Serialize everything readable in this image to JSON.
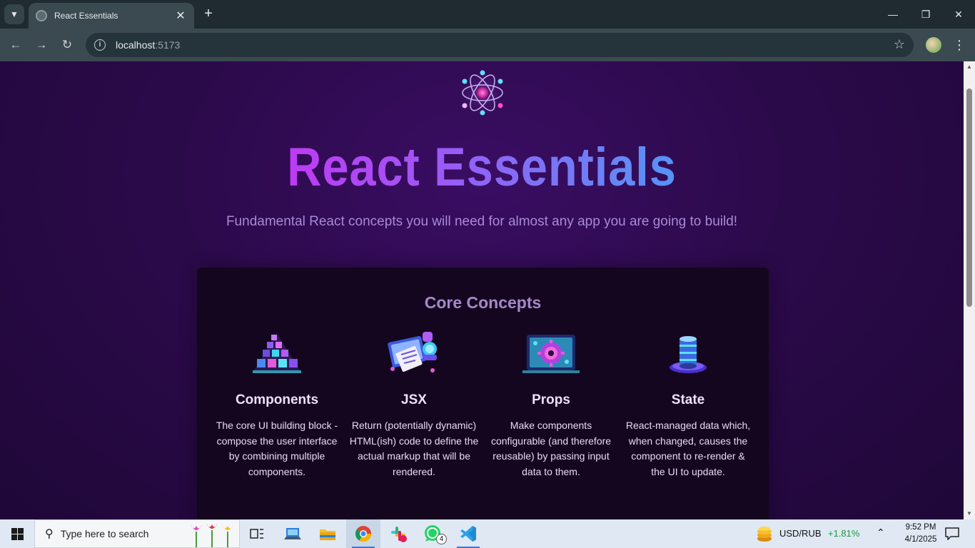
{
  "browser": {
    "tab_title": "React Essentials",
    "url_host": "localhost",
    "url_port": ":5173"
  },
  "page": {
    "title": "React Essentials",
    "subtitle": "Fundamental React concepts you will need for almost any app you are going to build!",
    "core_concepts": {
      "heading": "Core Concepts",
      "items": [
        {
          "name": "Components",
          "description": "The core UI building block - compose the user interface by combining multiple components."
        },
        {
          "name": "JSX",
          "description": "Return (potentially dynamic) HTML(ish) code to define the actual markup that will be rendered."
        },
        {
          "name": "Props",
          "description": "Make components configurable (and therefore reusable) by passing input data to them."
        },
        {
          "name": "State",
          "description": "React-managed data which, when changed, causes the component to re-render & the UI to update."
        }
      ]
    }
  },
  "taskbar": {
    "search_placeholder": "Type here to search",
    "whatsapp_badge": "4",
    "ticker_label": "USD/RUB",
    "ticker_change": "+1.81%",
    "time": "9:52 PM",
    "date": "4/1/2025"
  },
  "colors": {
    "title_gradient_start": "#e80ff2",
    "title_gradient_end": "#13c8f3",
    "page_background": "#2b0a4a",
    "card_background": "#15061f",
    "ticker_positive": "#1a9c3a"
  }
}
